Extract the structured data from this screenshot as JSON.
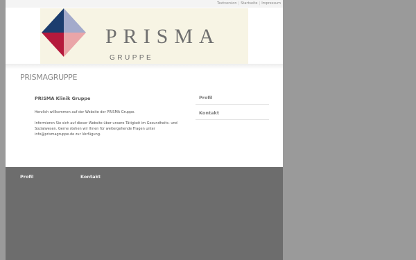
{
  "top_links": [
    {
      "label": "Textversion"
    },
    {
      "label": "Startseite"
    },
    {
      "label": "Impressum"
    }
  ],
  "logo": {
    "text": "PRISMA",
    "subtext": "GRUPPE",
    "colors": {
      "top_left": "#1b3d6e",
      "top_right": "#a3aacb",
      "bottom_left": "#b5193c",
      "bottom_right": "#eaa5a8",
      "background": "#f7f4e4"
    }
  },
  "site_heading": "PRISMAGRUPPE",
  "content": {
    "title": "PRISMA Klinik Gruppe",
    "paragraphs": [
      "Herzlich willkommen auf der Website der PRISMA Gruppe.",
      "Informieren Sie sich auf dieser Website über unsere Tätigkeit im Gesundheits- und Sozialwesen. Gerne stehen wir Ihnen für weitergehende Fragen unter info@prismagruppe.de zur Verfügung."
    ]
  },
  "sidebar": [
    {
      "label": "Profil"
    },
    {
      "label": "Kontakt"
    }
  ],
  "footer": [
    {
      "label": "Profil"
    },
    {
      "label": "Kontakt"
    }
  ],
  "colors": {
    "outer_background": "#9a9a9a",
    "footer_background": "#6d6d6d"
  }
}
